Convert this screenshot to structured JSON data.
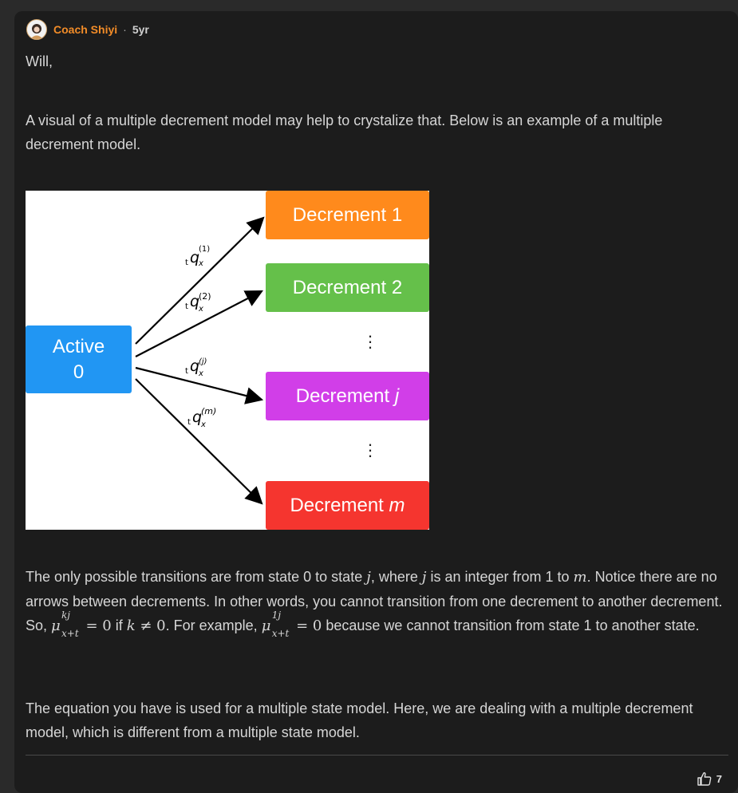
{
  "post": {
    "author": "Coach Shiyi",
    "separator": "·",
    "age": "5yr",
    "greeting": "Will,",
    "intro": "A visual of a multiple decrement model may help to crystalize that. Below is an example of a multiple decrement model.",
    "transitions": {
      "t1": "The only possible transitions are from state 0 to state ",
      "j": "j",
      "t2": ", where ",
      "t3": " is an integer from 1 to ",
      "m": "m",
      "t4": ". Notice there are no arrows between decrements. In other words, you cannot transition from one decrement to another decrement. So, ",
      "mu": "μ",
      "sup_kj": "kj",
      "sub": "x+t",
      "eq0": " = 0",
      "t5": " if ",
      "k": "k",
      "neq": " ≠ 0",
      "t6": ". For example, ",
      "sup_1j": "1j",
      "t7": " because we cannot transition from state 1 to another state."
    },
    "closing": "The equation you have is used for a multiple state model. Here, we are dealing with a multiple decrement model, which is different from a multiple state model.",
    "likes": "7"
  },
  "diagram": {
    "active_label": "Active",
    "active_state": "0",
    "decrement_1": "Decrement 1",
    "decrement_2": "Decrement 2",
    "decrement_j_prefix": "Decrement ",
    "decrement_j_var": "j",
    "decrement_m_prefix": "Decrement ",
    "decrement_m_var": "m",
    "prob_symbol": "q",
    "prob_pre": "t",
    "prob_sub": "x",
    "prob_sup_1": "(1)",
    "prob_sup_2": "(2)",
    "prob_sup_j": "(j)",
    "prob_sup_m": "(m)",
    "colors": {
      "active": "#2196f3",
      "d1": "#ff8a1c",
      "d2": "#65c04a",
      "dj": "#d13ee8",
      "dm": "#f5352f"
    }
  }
}
